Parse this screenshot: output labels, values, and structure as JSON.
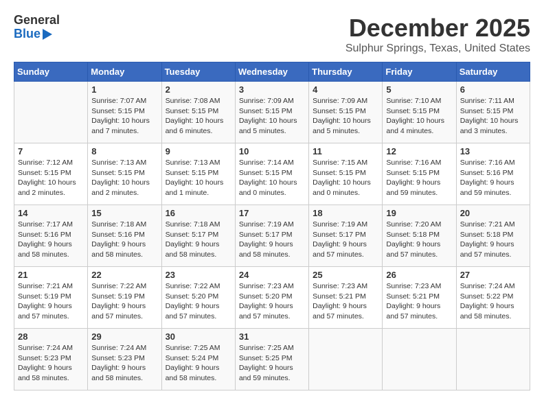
{
  "logo": {
    "general": "General",
    "blue": "Blue"
  },
  "title": "December 2025",
  "location": "Sulphur Springs, Texas, United States",
  "headers": [
    "Sunday",
    "Monday",
    "Tuesday",
    "Wednesday",
    "Thursday",
    "Friday",
    "Saturday"
  ],
  "weeks": [
    [
      {
        "day": "",
        "info": ""
      },
      {
        "day": "1",
        "info": "Sunrise: 7:07 AM\nSunset: 5:15 PM\nDaylight: 10 hours\nand 7 minutes."
      },
      {
        "day": "2",
        "info": "Sunrise: 7:08 AM\nSunset: 5:15 PM\nDaylight: 10 hours\nand 6 minutes."
      },
      {
        "day": "3",
        "info": "Sunrise: 7:09 AM\nSunset: 5:15 PM\nDaylight: 10 hours\nand 5 minutes."
      },
      {
        "day": "4",
        "info": "Sunrise: 7:09 AM\nSunset: 5:15 PM\nDaylight: 10 hours\nand 5 minutes."
      },
      {
        "day": "5",
        "info": "Sunrise: 7:10 AM\nSunset: 5:15 PM\nDaylight: 10 hours\nand 4 minutes."
      },
      {
        "day": "6",
        "info": "Sunrise: 7:11 AM\nSunset: 5:15 PM\nDaylight: 10 hours\nand 3 minutes."
      }
    ],
    [
      {
        "day": "7",
        "info": "Sunrise: 7:12 AM\nSunset: 5:15 PM\nDaylight: 10 hours\nand 2 minutes."
      },
      {
        "day": "8",
        "info": "Sunrise: 7:13 AM\nSunset: 5:15 PM\nDaylight: 10 hours\nand 2 minutes."
      },
      {
        "day": "9",
        "info": "Sunrise: 7:13 AM\nSunset: 5:15 PM\nDaylight: 10 hours\nand 1 minute."
      },
      {
        "day": "10",
        "info": "Sunrise: 7:14 AM\nSunset: 5:15 PM\nDaylight: 10 hours\nand 0 minutes."
      },
      {
        "day": "11",
        "info": "Sunrise: 7:15 AM\nSunset: 5:15 PM\nDaylight: 10 hours\nand 0 minutes."
      },
      {
        "day": "12",
        "info": "Sunrise: 7:16 AM\nSunset: 5:15 PM\nDaylight: 9 hours\nand 59 minutes."
      },
      {
        "day": "13",
        "info": "Sunrise: 7:16 AM\nSunset: 5:16 PM\nDaylight: 9 hours\nand 59 minutes."
      }
    ],
    [
      {
        "day": "14",
        "info": "Sunrise: 7:17 AM\nSunset: 5:16 PM\nDaylight: 9 hours\nand 58 minutes."
      },
      {
        "day": "15",
        "info": "Sunrise: 7:18 AM\nSunset: 5:16 PM\nDaylight: 9 hours\nand 58 minutes."
      },
      {
        "day": "16",
        "info": "Sunrise: 7:18 AM\nSunset: 5:17 PM\nDaylight: 9 hours\nand 58 minutes."
      },
      {
        "day": "17",
        "info": "Sunrise: 7:19 AM\nSunset: 5:17 PM\nDaylight: 9 hours\nand 58 minutes."
      },
      {
        "day": "18",
        "info": "Sunrise: 7:19 AM\nSunset: 5:17 PM\nDaylight: 9 hours\nand 57 minutes."
      },
      {
        "day": "19",
        "info": "Sunrise: 7:20 AM\nSunset: 5:18 PM\nDaylight: 9 hours\nand 57 minutes."
      },
      {
        "day": "20",
        "info": "Sunrise: 7:21 AM\nSunset: 5:18 PM\nDaylight: 9 hours\nand 57 minutes."
      }
    ],
    [
      {
        "day": "21",
        "info": "Sunrise: 7:21 AM\nSunset: 5:19 PM\nDaylight: 9 hours\nand 57 minutes."
      },
      {
        "day": "22",
        "info": "Sunrise: 7:22 AM\nSunset: 5:19 PM\nDaylight: 9 hours\nand 57 minutes."
      },
      {
        "day": "23",
        "info": "Sunrise: 7:22 AM\nSunset: 5:20 PM\nDaylight: 9 hours\nand 57 minutes."
      },
      {
        "day": "24",
        "info": "Sunrise: 7:23 AM\nSunset: 5:20 PM\nDaylight: 9 hours\nand 57 minutes."
      },
      {
        "day": "25",
        "info": "Sunrise: 7:23 AM\nSunset: 5:21 PM\nDaylight: 9 hours\nand 57 minutes."
      },
      {
        "day": "26",
        "info": "Sunrise: 7:23 AM\nSunset: 5:21 PM\nDaylight: 9 hours\nand 57 minutes."
      },
      {
        "day": "27",
        "info": "Sunrise: 7:24 AM\nSunset: 5:22 PM\nDaylight: 9 hours\nand 58 minutes."
      }
    ],
    [
      {
        "day": "28",
        "info": "Sunrise: 7:24 AM\nSunset: 5:23 PM\nDaylight: 9 hours\nand 58 minutes."
      },
      {
        "day": "29",
        "info": "Sunrise: 7:24 AM\nSunset: 5:23 PM\nDaylight: 9 hours\nand 58 minutes."
      },
      {
        "day": "30",
        "info": "Sunrise: 7:25 AM\nSunset: 5:24 PM\nDaylight: 9 hours\nand 58 minutes."
      },
      {
        "day": "31",
        "info": "Sunrise: 7:25 AM\nSunset: 5:25 PM\nDaylight: 9 hours\nand 59 minutes."
      },
      {
        "day": "",
        "info": ""
      },
      {
        "day": "",
        "info": ""
      },
      {
        "day": "",
        "info": ""
      }
    ]
  ]
}
